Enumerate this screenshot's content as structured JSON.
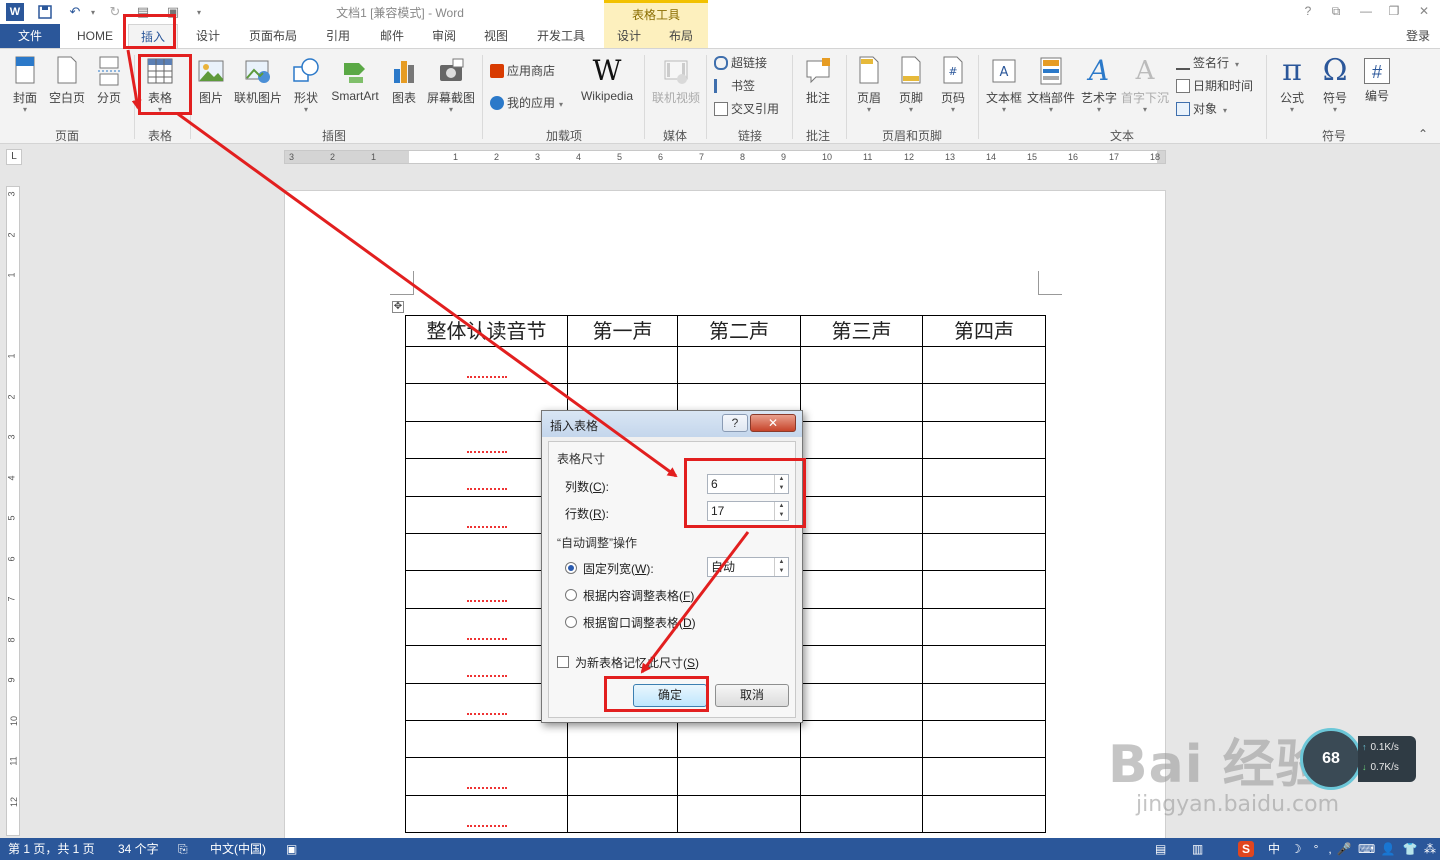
{
  "window": {
    "title": "文档1 [兼容模式] - Word",
    "context_tools_label": "表格工具",
    "login": "登录",
    "controls": [
      "?",
      "⧉",
      "—",
      "❐",
      "✕"
    ]
  },
  "tabs": [
    "文件",
    "HOME",
    "插入",
    "设计",
    "页面布局",
    "引用",
    "邮件",
    "审阅",
    "视图",
    "开发工具"
  ],
  "context_tabs": [
    "设计",
    "布局"
  ],
  "ribbon": {
    "page_group": {
      "label": "页面",
      "buttons": [
        "封面",
        "空白页",
        "分页"
      ]
    },
    "table_group": {
      "label": "表格",
      "button": "表格"
    },
    "illustrations_group": {
      "label": "插图",
      "buttons": [
        "图片",
        "联机图片",
        "形状",
        "SmartArt",
        "图表",
        "屏幕截图"
      ]
    },
    "addins_group": {
      "label": "加载项",
      "store": "应用商店",
      "my_apps": "我的应用",
      "wikipedia": "Wikipedia"
    },
    "media_group": {
      "label": "媒体",
      "button": "联机视频"
    },
    "links_group": {
      "label": "链接",
      "items": [
        "超链接",
        "书签",
        "交叉引用"
      ]
    },
    "comments_group": {
      "label": "批注",
      "button": "批注"
    },
    "header_footer_group": {
      "label": "页眉和页脚",
      "buttons": [
        "页眉",
        "页脚",
        "页码"
      ]
    },
    "text_group": {
      "label": "文本",
      "buttons": [
        "文本框",
        "文档部件",
        "艺术字",
        "首字下沉"
      ],
      "items": [
        "签名行",
        "日期和时间",
        "对象"
      ]
    },
    "symbols_group": {
      "label": "符号",
      "buttons": [
        "公式",
        "符号",
        "编号"
      ],
      "glyphs": [
        "π",
        "Ω",
        "#"
      ]
    }
  },
  "ruler": {
    "top_ticks": [
      "3",
      "2",
      "1",
      "",
      "1",
      "2",
      "3",
      "4",
      "5",
      "6",
      "7",
      "8",
      "9",
      "10",
      "11",
      "12",
      "13",
      "14",
      "15",
      "16",
      "17",
      "18"
    ],
    "left_ticks": [
      "3",
      "2",
      "1",
      "",
      "1",
      "2",
      "3",
      "4",
      "5",
      "6",
      "7",
      "8",
      "9",
      "10",
      "11",
      "12"
    ]
  },
  "document": {
    "table_header": [
      "整体认读音节",
      "第一声",
      "第二声",
      "第三声",
      "第四声"
    ],
    "table_body_rows": 13,
    "squiggle_rows": [
      0,
      2,
      3,
      4,
      6,
      7,
      8,
      9,
      11,
      12
    ]
  },
  "dialog": {
    "title": "插入表格",
    "help": "?",
    "close": "✕",
    "size_section": "表格尺寸",
    "columns_label": "列数(",
    "columns_key": "C",
    "columns_value": "6",
    "rows_label": "行数(",
    "rows_key": "R",
    "rows_value": "17",
    "autofit_section": "“自动调整”操作",
    "fixed_label": "固定列宽(",
    "fixed_key": "W",
    "fixed_value": "自动",
    "content_label": "根据内容调整表格(",
    "content_key": "F",
    "window_label": "根据窗口调整表格(",
    "window_key": "D",
    "remember_label": "为新表格记忆此尺寸(",
    "remember_key": "S",
    "ok": "确定",
    "cancel": "取消"
  },
  "speed": {
    "center": "68",
    "up": "0.1K/s",
    "down": "0.7K/s"
  },
  "watermark": {
    "main": "Bai 经验",
    "sub": "jingyan.baidu.com"
  },
  "status": {
    "page": "第 1 页，共 1 页",
    "words": "34 个字",
    "language": "中文(中国)",
    "tray": [
      "S",
      "中",
      "☽",
      "°",
      ",",
      "🎤",
      "⌨",
      "👤",
      "👕",
      "⁂"
    ]
  },
  "annotation_color": "#e21f1f",
  "brand_color": "#2b579a"
}
